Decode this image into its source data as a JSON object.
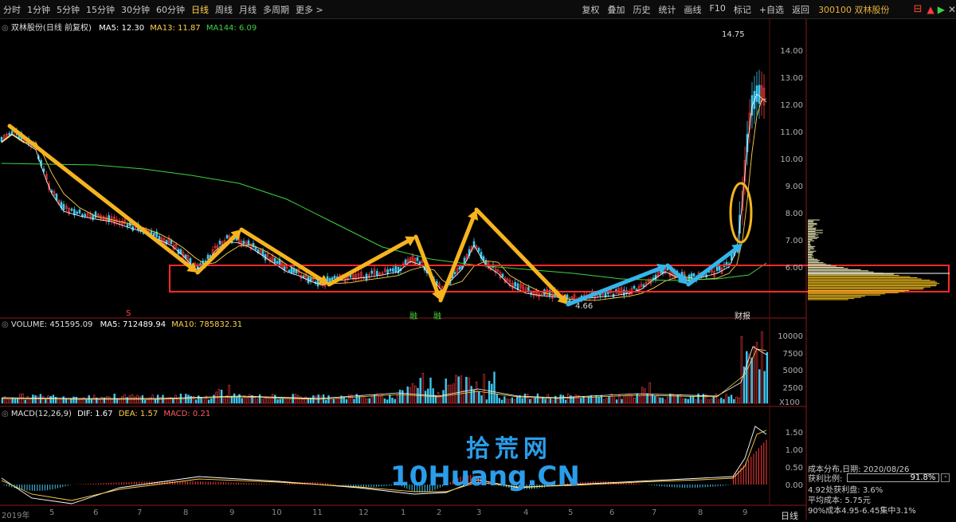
{
  "toolbar": {
    "periods": [
      "分时",
      "1分钟",
      "5分钟",
      "15分钟",
      "30分钟",
      "60分钟",
      "日线",
      "周线",
      "月线",
      "多周期",
      "更多 >"
    ],
    "active_period": "日线",
    "tools": [
      "复权",
      "叠加",
      "历史",
      "统计",
      "画线",
      "F10",
      "标记",
      "+自选",
      "返回"
    ],
    "stock_code": "300100 双林股份"
  },
  "main_chart": {
    "title": "双林股份(日线 前复权)",
    "ma5": "MA5: 12.30",
    "ma13": "MA13: 11.87",
    "ma144": "MA144: 6.09",
    "high_label": "14.75",
    "low_label": "4.66",
    "event_labels": [
      "S",
      "融",
      "融",
      "财报"
    ],
    "y_ticks": [
      "14.00",
      "13.00",
      "12.00",
      "11.00",
      "10.00",
      "9.00",
      "8.00",
      "7.00",
      "6.00"
    ]
  },
  "volume_chart": {
    "title": "VOLUME: 451595.09",
    "ma5": "MA5: 712489.94",
    "ma10": "MA10: 785832.31",
    "y_ticks": [
      "10000",
      "7500",
      "5000",
      "2500"
    ],
    "unit": "X100"
  },
  "macd_chart": {
    "title": "MACD(12,26,9)",
    "dif": "DIF: 1.67",
    "dea": "DEA: 1.57",
    "macd": "MACD: 0.21",
    "y_ticks": [
      "1.50",
      "1.00",
      "0.50",
      "0.00"
    ]
  },
  "x_axis": {
    "labels": [
      "2019年",
      "5",
      "6",
      "7",
      "8",
      "9",
      "10",
      "11",
      "12",
      "1",
      "2",
      "3",
      "4",
      "5",
      "6",
      "7",
      "8",
      "9"
    ]
  },
  "cost_panel": {
    "title": "成本分布,日期: 2020/08/26",
    "profit_label": "获利比例:",
    "profit_value": "91.8%",
    "line2": "4.92处获利盘: 3.6%",
    "line3": "平均成本: 5.75元",
    "line4": "90%成本4.95-6.45集中3.1%"
  },
  "bottom_label": "日线",
  "watermark": {
    "line1": "拾荒网",
    "line2": "10Huang.CN"
  },
  "colors": {
    "up": "#ff3b3b",
    "down": "#3ec8f0",
    "ma5": "#ffffff",
    "ma13": "#ffd24a",
    "ma144": "#3fd33f",
    "annotation": "#f5b41e",
    "annotation_blue": "#35b5ea",
    "box": "#ff2a2a"
  }
}
